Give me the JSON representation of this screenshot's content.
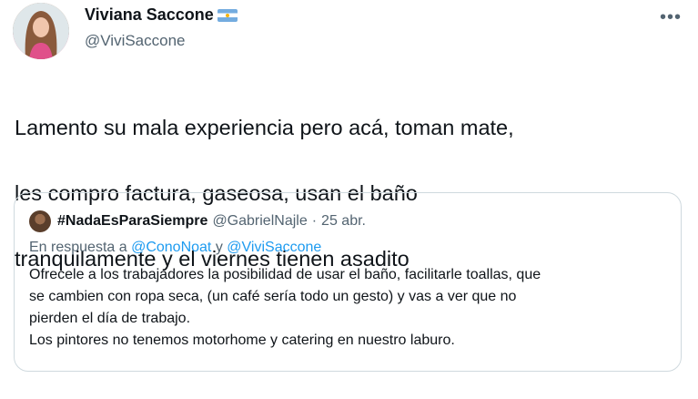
{
  "author": {
    "display_name": "Viviana Saccone",
    "handle": "@ViviSaccone",
    "flag_icon": "argentina-flag-icon",
    "more_icon": "more-options-icon"
  },
  "tweet": {
    "lines": [
      "Lamento su mala experiencia pero acá, toman mate,",
      "les compro factura, gaseosa, usan el baño",
      "tranquilamente y el viernes tienen asadito"
    ]
  },
  "quoted": {
    "display_name": "#NadaEsParaSiempre",
    "handle": "@GabrielNajle",
    "separator": "·",
    "date": "25 abr.",
    "reply_prefix": "En respuesta a",
    "reply_mention_1": "@ConoNoat",
    "reply_connector": "y",
    "reply_mention_2": "@ViviSaccone",
    "body_lines": [
      "Ofrecele a los trabajadores la posibilidad de usar el baño, facilitarle toallas, que",
      "se cambien con ropa seca, (un café sería todo un gesto) y vas a ver que no",
      "pierden el día de trabajo.",
      "Los pintores no tenemos motorhome y catering en nuestro laburo."
    ]
  },
  "colors": {
    "text_primary": "#0f1419",
    "text_secondary": "#536471",
    "link": "#1d9bf0",
    "border": "#cfd9de"
  }
}
